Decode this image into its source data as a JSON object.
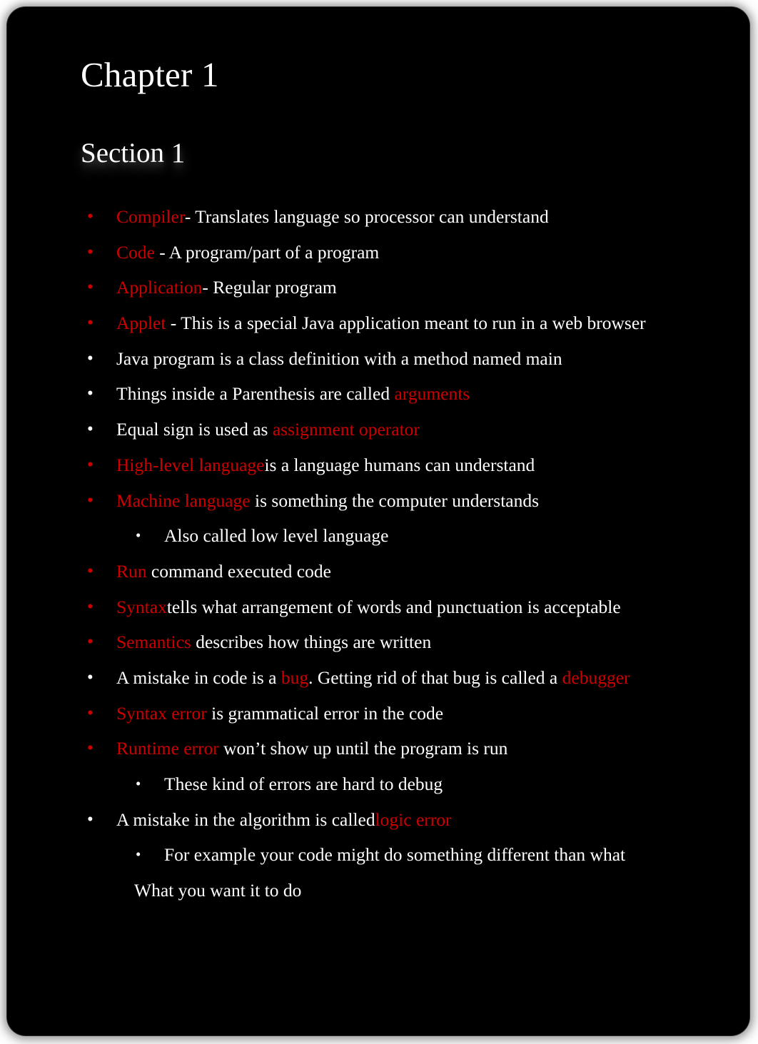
{
  "slide": {
    "title": "Chapter 1",
    "subtitle": "Section 1",
    "colors": {
      "background": "#000000",
      "text": "#ffffff",
      "keyword": "#cc0000",
      "page": "#ffffff"
    },
    "bullets": [
      {
        "level": 1,
        "bullet_color": "keyword",
        "bullet_glyph": "•",
        "segments": [
          {
            "text": "Compiler",
            "color": "keyword"
          },
          {
            "text": "- Translates language so processor can understand",
            "color": "text"
          }
        ],
        "plain_text": "Compiler - Translates language so processor can understand"
      },
      {
        "level": 1,
        "bullet_color": "keyword",
        "bullet_glyph": "•",
        "segments": [
          {
            "text": "Code ",
            "color": "keyword"
          },
          {
            "text": "- A program/part of a program",
            "color": "text"
          }
        ],
        "plain_text": "Code - A program/part of a program"
      },
      {
        "level": 1,
        "bullet_color": "keyword",
        "bullet_glyph": "•",
        "segments": [
          {
            "text": "Application",
            "color": "keyword"
          },
          {
            "text": "- Regular program",
            "color": "text"
          }
        ],
        "plain_text": "Application- Regular program"
      },
      {
        "level": 1,
        "bullet_color": "keyword",
        "bullet_glyph": "•",
        "segments": [
          {
            "text": "Applet",
            "color": "keyword"
          },
          {
            "text": " - This is a special Java application meant to run in a web browser",
            "color": "text"
          }
        ],
        "plain_text": "Applet - This is a special Java application meant to run in a web browser"
      },
      {
        "level": 1,
        "bullet_color": "text",
        "bullet_glyph": "•",
        "segments": [
          {
            "text": "Java program is a class definition with a method named main",
            "color": "text"
          }
        ],
        "plain_text": "Java program is a class definition with a method named main"
      },
      {
        "level": 1,
        "bullet_color": "text",
        "bullet_glyph": "•",
        "segments": [
          {
            "text": "Things inside a Parenthesis are called ",
            "color": "text"
          },
          {
            "text": "arguments",
            "color": "keyword"
          }
        ],
        "plain_text": "Things inside a Parenthesis are called arguments"
      },
      {
        "level": 1,
        "bullet_color": "text",
        "bullet_glyph": "•",
        "segments": [
          {
            "text": "Equal sign is used as ",
            "color": "text"
          },
          {
            "text": "assignment operator",
            "color": "keyword"
          }
        ],
        "plain_text": "Equal sign is used as assignment operator"
      },
      {
        "level": 1,
        "bullet_color": "keyword",
        "bullet_glyph": "•",
        "segments": [
          {
            "text": "High-level language",
            "color": "keyword"
          },
          {
            "text": "is a language humans can understand",
            "color": "text"
          }
        ],
        "plain_text": "High-level language is a language humans can understand"
      },
      {
        "level": 1,
        "bullet_color": "keyword",
        "bullet_glyph": "•",
        "segments": [
          {
            "text": "Machine language",
            "color": "keyword"
          },
          {
            "text": " is something the computer understands",
            "color": "text"
          }
        ],
        "plain_text": "Machine language is something the computer understands"
      },
      {
        "level": 2,
        "bullet_color": "text",
        "bullet_glyph": "•",
        "segments": [
          {
            "text": "Also called low level language",
            "color": "text"
          }
        ],
        "plain_text": "Also called low level language"
      },
      {
        "level": 1,
        "bullet_color": "keyword",
        "bullet_glyph": "•",
        "segments": [
          {
            "text": "Run ",
            "color": "keyword"
          },
          {
            "text": "command executed code",
            "color": "text"
          }
        ],
        "plain_text": "Run command executed code"
      },
      {
        "level": 1,
        "bullet_color": "keyword",
        "bullet_glyph": "•",
        "segments": [
          {
            "text": "Syntax",
            "color": "keyword"
          },
          {
            "text": "tells what arrangement of words and punctuation is acceptable",
            "color": "text"
          }
        ],
        "plain_text": "Syntax tells what arrangement of words and punctuation is acceptable"
      },
      {
        "level": 1,
        "bullet_color": "keyword",
        "bullet_glyph": "•",
        "segments": [
          {
            "text": "Semantics",
            "color": "keyword"
          },
          {
            "text": " describes how things are written",
            "color": "text"
          }
        ],
        "plain_text": "Semantics describes how things are written"
      },
      {
        "level": 1,
        "bullet_color": "text",
        "bullet_glyph": "•",
        "segments": [
          {
            "text": "A mistake in code is a ",
            "color": "text"
          },
          {
            "text": "bug",
            "color": "keyword"
          },
          {
            "text": ". Getting rid of that bug is called a ",
            "color": "text"
          },
          {
            "text": "debugger",
            "color": "keyword"
          }
        ],
        "plain_text": "A mistake in code is a bug. Getting rid of that bug is called a debugger"
      },
      {
        "level": 1,
        "bullet_color": "keyword",
        "bullet_glyph": "•",
        "segments": [
          {
            "text": "Syntax error",
            "color": "keyword"
          },
          {
            "text": " is grammatical error in the code",
            "color": "text"
          }
        ],
        "plain_text": "Syntax error is grammatical error in the code"
      },
      {
        "level": 1,
        "bullet_color": "keyword",
        "bullet_glyph": "•",
        "segments": [
          {
            "text": "Runtime error",
            "color": "keyword"
          },
          {
            "text": "  won’t show up until the program is run",
            "color": "text"
          }
        ],
        "plain_text": "Runtime error won’t show up until the program is run"
      },
      {
        "level": 2,
        "bullet_color": "text",
        "bullet_glyph": "•",
        "segments": [
          {
            "text": "These kind of errors are hard to debug",
            "color": "text"
          }
        ],
        "plain_text": "These kind of errors are hard to debug"
      },
      {
        "level": 1,
        "bullet_color": "text",
        "bullet_glyph": "•",
        "segments": [
          {
            "text": "A mistake in the algorithm is called",
            "color": "text"
          },
          {
            "text": "logic error",
            "color": "keyword"
          }
        ],
        "plain_text": "A mistake in the algorithm is called logic error"
      },
      {
        "level": 2,
        "bullet_color": "text",
        "bullet_glyph": "•",
        "segments": [
          {
            "text": "For example your code might do something different than what",
            "color": "text"
          }
        ],
        "plain_text": "For example your code might do something different than what"
      },
      {
        "level": 0,
        "bullet_color": "none",
        "bullet_glyph": "",
        "continuation": true,
        "segments": [
          {
            "text": "What you want it to do",
            "color": "text"
          }
        ],
        "plain_text": "What you want it to do"
      }
    ]
  }
}
